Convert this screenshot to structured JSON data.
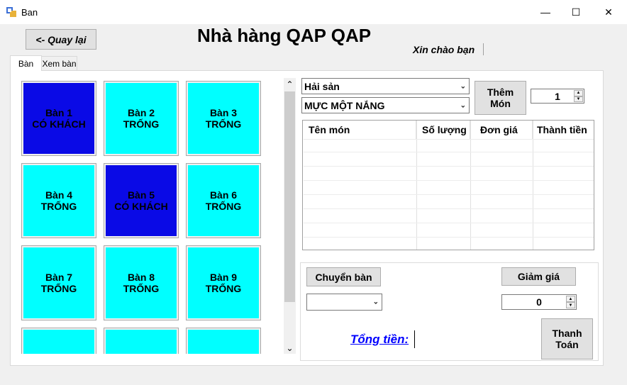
{
  "window": {
    "title": "Ban",
    "minimize": "—",
    "maximize": "☐",
    "close": "✕"
  },
  "header": {
    "back_label": "<- Quay lại",
    "title": "Nhà hàng QAP QAP",
    "greeting": "Xin chào bạn"
  },
  "tabs": [
    {
      "label": "Bàn"
    },
    {
      "label": "Xem bàn"
    }
  ],
  "tables": [
    {
      "name": "Bàn 1",
      "status": "CÓ KHÁCH"
    },
    {
      "name": "Bàn 2",
      "status": "TRỐNG"
    },
    {
      "name": "Bàn 3",
      "status": "TRỐNG"
    },
    {
      "name": "Bàn 4",
      "status": "TRỐNG"
    },
    {
      "name": "Bàn 5",
      "status": "CÓ KHÁCH"
    },
    {
      "name": "Bàn 6",
      "status": "TRỐNG"
    },
    {
      "name": "Bàn 7",
      "status": "TRỐNG"
    },
    {
      "name": "Bàn 8",
      "status": "TRỐNG"
    },
    {
      "name": "Bàn 9",
      "status": "TRỐNG"
    },
    {
      "name": "",
      "status": ""
    },
    {
      "name": "",
      "status": ""
    },
    {
      "name": "",
      "status": ""
    }
  ],
  "colors": {
    "occupied": "#0a0ae6",
    "free": "#00ffff",
    "link": "#0000ff"
  },
  "order": {
    "category_selected": "Hải sản",
    "dish_selected": "MỰC MỘT NẮNG",
    "add_label_line1": "Thêm",
    "add_label_line2": "Món",
    "quantity": "1",
    "columns": [
      "Tên món",
      "Số lượng",
      "Đơn giá",
      "Thành tiền"
    ]
  },
  "actions": {
    "switch_table_label": "Chuyển bàn",
    "switch_table_selected": "",
    "discount_label": "Giảm giá",
    "discount_value": "0",
    "total_label": "Tổng tiền:",
    "pay_line1": "Thanh",
    "pay_line2": "Toán"
  },
  "icons": {
    "scroll_up": "⌃",
    "scroll_down": "⌄",
    "dropdown": "⌄"
  }
}
